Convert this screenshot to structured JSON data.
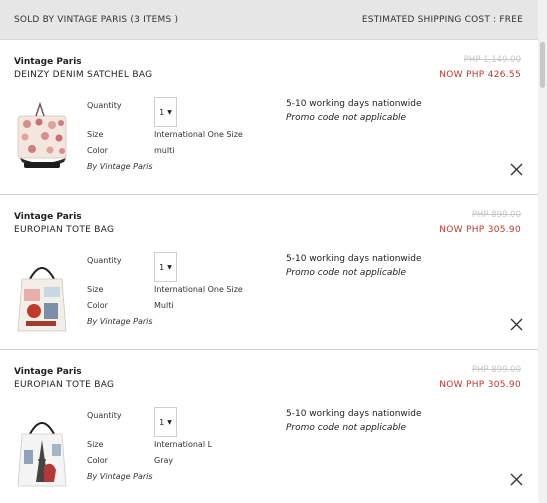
{
  "header": {
    "seller_label": "SOLD BY VINTAGE PARIS (3 ITEMS )",
    "shipping_label": "ESTIMATED SHIPPING COST : FREE"
  },
  "labels": {
    "quantity": "Quantity",
    "size": "Size",
    "color": "Color"
  },
  "items": [
    {
      "brand": "Vintage Paris",
      "title": "DEINZY DENIM SATCHEL BAG",
      "old_price": "PHP 1,149.00",
      "new_price": "NOW PHP 426.55",
      "quantity": "1",
      "size": "International One Size",
      "color": "multi",
      "by": "By Vintage Paris",
      "delivery": "5-10 working days nationwide",
      "promo": "Promo code not applicable",
      "image_icon": "satchel-bag-product-image"
    },
    {
      "brand": "Vintage Paris",
      "title": "EUROPIAN TOTE BAG",
      "old_price": "PHP 899.00",
      "new_price": "NOW PHP 305.90",
      "quantity": "1",
      "size": "International One Size",
      "color": "Multi",
      "by": "By Vintage Paris",
      "delivery": "5-10 working days nationwide",
      "promo": "Promo code not applicable",
      "image_icon": "tote-bag-product-image"
    },
    {
      "brand": "Vintage Paris",
      "title": "EUROPIAN TOTE BAG",
      "old_price": "PHP 899.00",
      "new_price": "NOW PHP 305.90",
      "quantity": "1",
      "size": "International L",
      "color": "Gray",
      "by": "By Vintage Paris",
      "delivery": "5-10 working days nationwide",
      "promo": "Promo code not applicable",
      "image_icon": "tote-bag-product-image"
    }
  ],
  "colors": {
    "header_bg": "#e6e6e6",
    "sale_price": "#c0392b",
    "old_price": "#c8c8c8"
  }
}
